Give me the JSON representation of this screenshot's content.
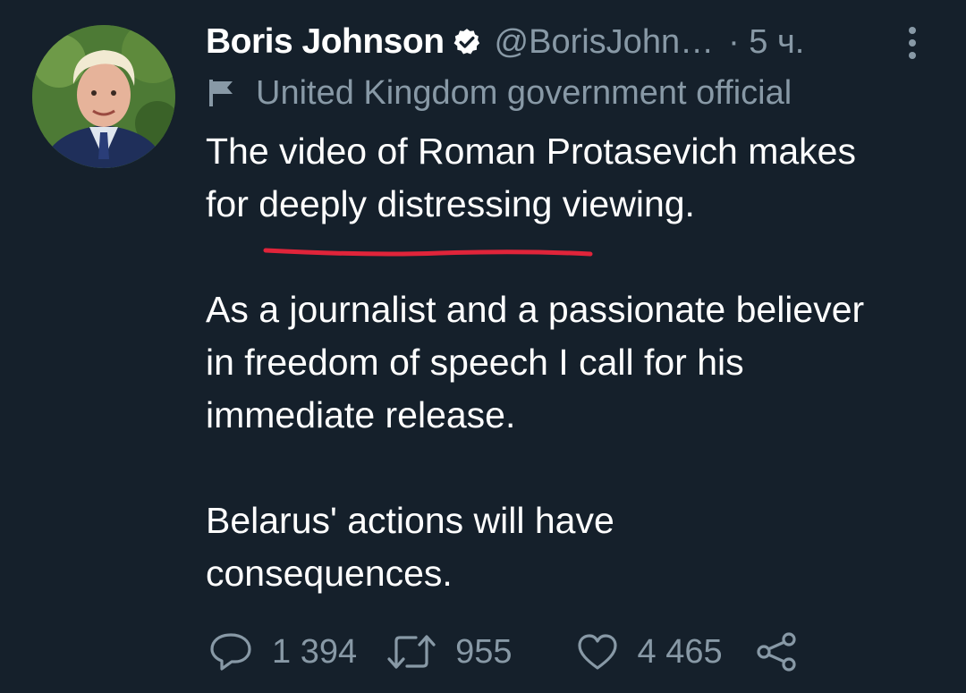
{
  "tweet": {
    "author": {
      "name": "Boris Johnson",
      "handle": "@BorisJohn…",
      "verified": true
    },
    "time": "· 5 ч.",
    "label": "United Kingdom government official",
    "paragraphs": [
      "The video of Roman Protasevich makes\nfor deeply distressing viewing.",
      "As a journalist and a passionate believer\nin freedom of speech I call for his\nimmediate release.",
      "Belarus' actions will have\nconsequences."
    ],
    "counts": {
      "replies": "1 394",
      "retweets": "955",
      "likes": "4 465"
    }
  },
  "colors": {
    "background": "#15202b",
    "text": "#ffffff",
    "secondary": "#8899a6",
    "underline_annotation": "#e0243a"
  },
  "icons": [
    "verified-badge-icon",
    "more-options-icon",
    "flag-icon",
    "reply-icon",
    "retweet-icon",
    "like-icon",
    "share-icon"
  ]
}
